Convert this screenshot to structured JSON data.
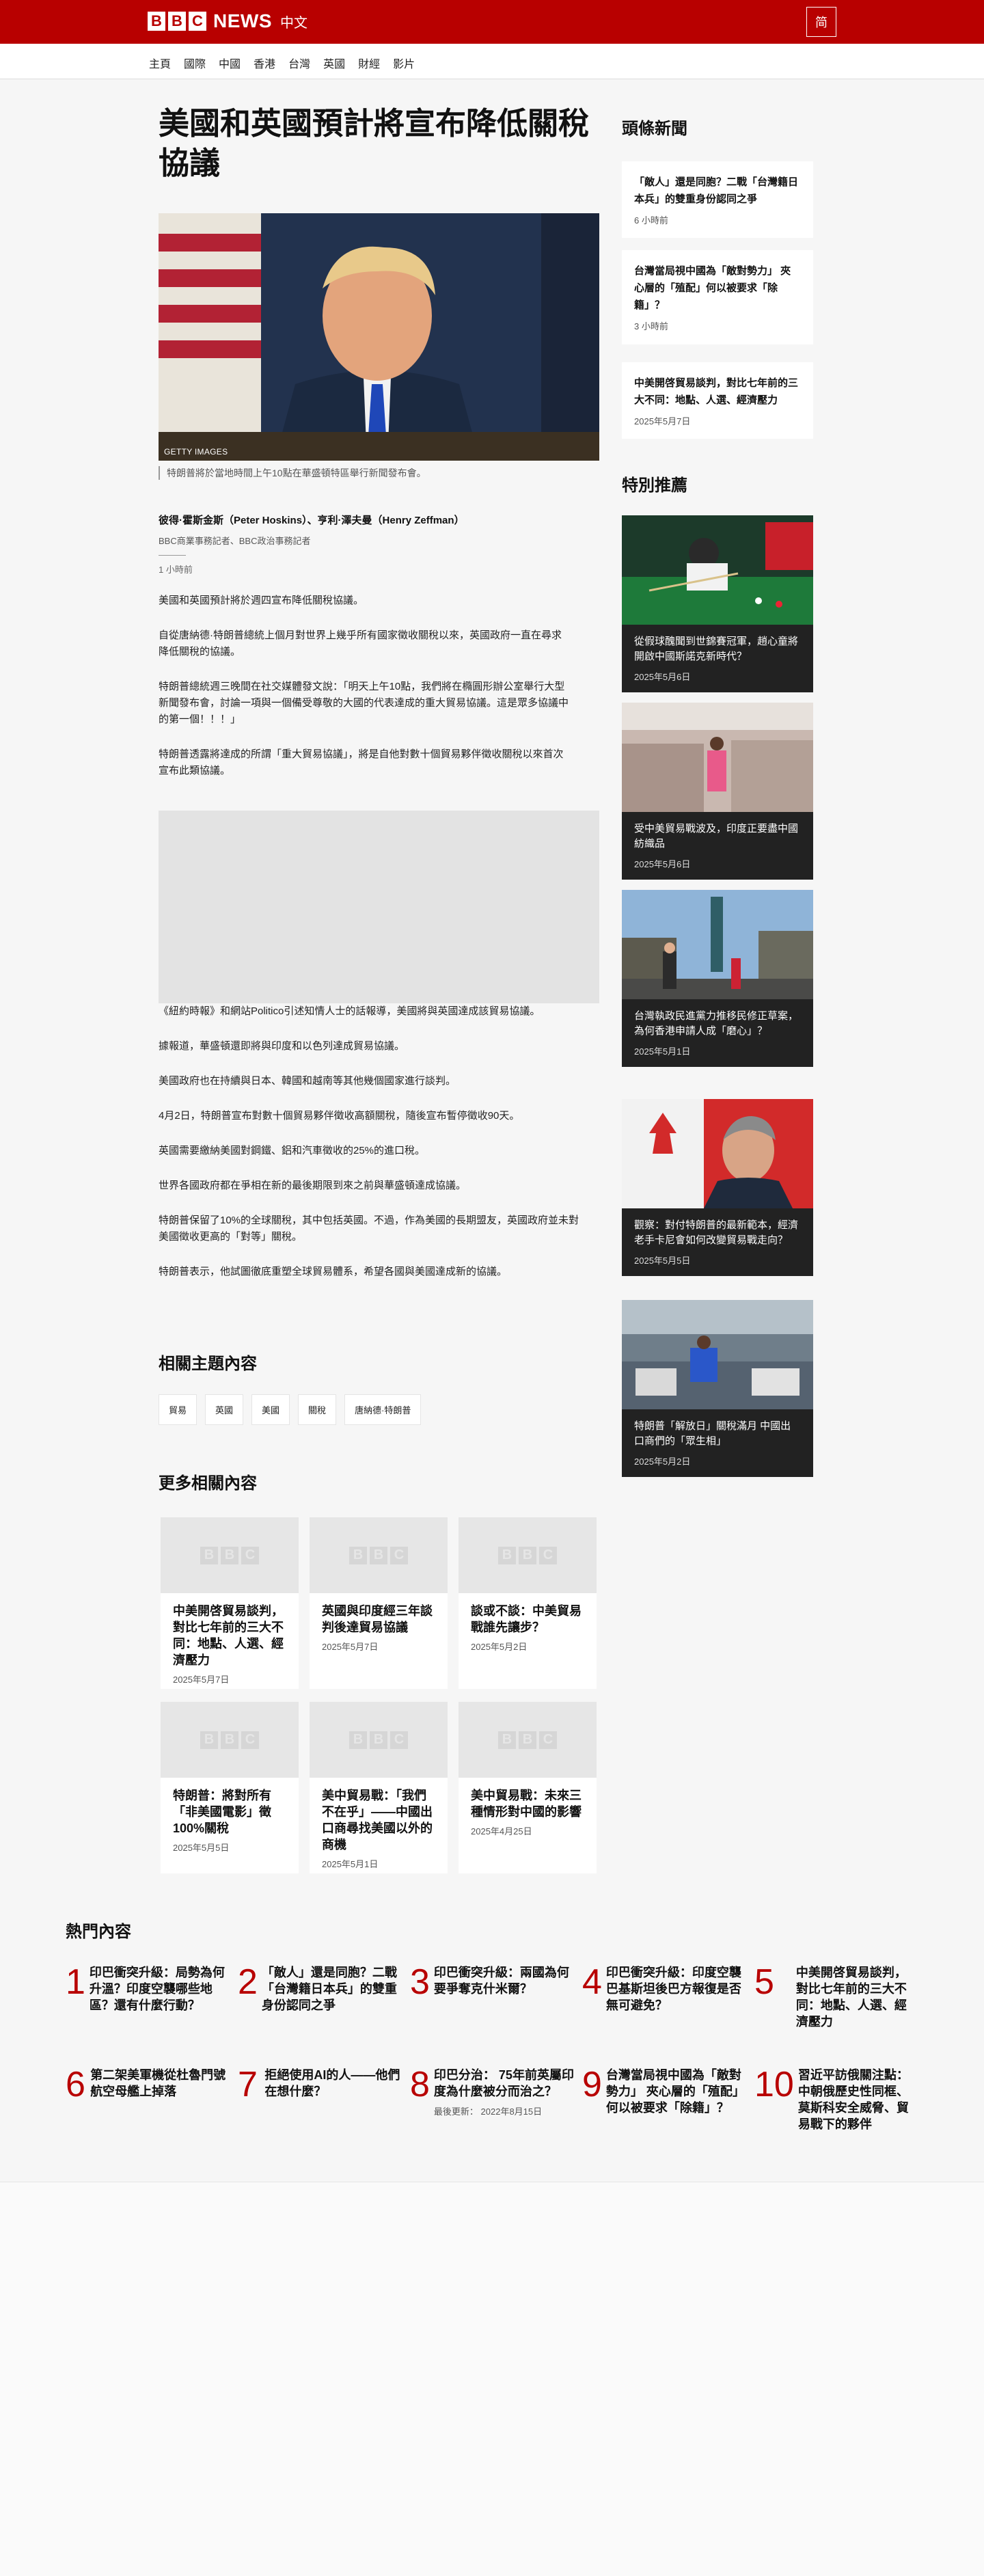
{
  "header": {
    "logo_letters": [
      "B",
      "B",
      "C"
    ],
    "brand": "NEWS",
    "edition": "中文",
    "lang_toggle": "简"
  },
  "nav": {
    "items": [
      "主頁",
      "國際",
      "中國",
      "香港",
      "台灣",
      "英國",
      "財經",
      "影片"
    ]
  },
  "article": {
    "headline": "美國和英國預計將宣布降低關稅協議",
    "image_credit": "GETTY IMAGES",
    "caption": "特朗普將於當地時間上午10點在華盛頓特區舉行新聞發布會。",
    "author": "彼得·霍斯金斯（Peter Hoskins）、亨利·澤夫曼（Henry Zeffman）",
    "author_role": "BBC商業事務記者、BBC政治事務記者",
    "time": "1 小時前",
    "paragraphs_a": [
      "美國和英國預計將於週四宣布降低關稅協議。",
      "自從唐納德·特朗普總統上個月對世界上幾乎所有國家徵收關稅以來，英國政府一直在尋求降低關稅的協議。",
      "特朗普總統週三晚間在社交媒體發文說：「明天上午10點，我們將在橢圓形辦公室舉行大型新聞發布會，討論一項與一個備受尊敬的大國的代表達成的重大貿易協議。這是眾多協議中的第一個！！！」",
      "特朗普透露將達成的所謂「重大貿易協議」，將是自他對數十個貿易夥伴徵收關稅以來首次宣布此類協議。"
    ],
    "paragraphs_b": [
      "《紐約時報》和網站Politico引述知情人士的話報導，美國將與英國達成該貿易協議。",
      "據報道，華盛頓還即將與印度和以色列達成貿易協議。",
      "美國政府也在持續與日本、韓國和越南等其他幾個國家進行談判。",
      "4月2日，特朗普宣布對數十個貿易夥伴徵收高額關稅，隨後宣布暫停徵收90天。",
      "英國需要繳納美國對鋼鐵、鋁和汽車徵收的25%的進口稅。",
      "世界各國政府都在爭相在新的最後期限到來之前與華盛頓達成協議。",
      "特朗普保留了10%的全球關稅，其中包括英國。不過，作為美國的長期盟友，英國政府並未對美國徵收更高的「對等」關稅。",
      "特朗普表示，他試圖徹底重塑全球貿易體系，希望各國與美國達成新的協議。"
    ]
  },
  "related_topics": {
    "heading": "相關主題內容",
    "tags": [
      "貿易",
      "英國",
      "美國",
      "關稅",
      "唐納德·特朗普"
    ]
  },
  "more_related": {
    "heading": "更多相關內容",
    "cards": [
      {
        "title": "中美開啓貿易談判，對比七年前的三大不同：地點、人選、經濟壓力",
        "date": "2025年5月7日"
      },
      {
        "title": "英國與印度經三年談判後達貿易協議",
        "date": "2025年5月7日"
      },
      {
        "title": "談或不談：中美貿易戰誰先讓步？",
        "date": "2025年5月2日"
      },
      {
        "title": "特朗普：將對所有「非美國電影」徵100%關稅",
        "date": "2025年5月5日"
      },
      {
        "title": "美中貿易戰：「我們不在乎」——中國出口商尋找美國以外的商機",
        "date": "2025年5月1日"
      },
      {
        "title": "美中貿易戰：未來三種情形對中國的影響",
        "date": "2025年4月25日"
      }
    ]
  },
  "hot": {
    "heading": "熱門內容",
    "items": [
      {
        "num": "1",
        "title": "印巴衝突升級：局勢為何升溫？印度空襲哪些地區？還有什麼行動？",
        "meta": ""
      },
      {
        "num": "2",
        "title": "「敵人」還是同胞？二戰「台灣籍日本兵」的雙重身份認同之爭",
        "meta": ""
      },
      {
        "num": "3",
        "title": "印巴衝突升級：兩國為何要爭奪克什米爾？",
        "meta": ""
      },
      {
        "num": "4",
        "title": "印巴衝突升級：印度空襲巴基斯坦後巴方報復是否無可避免？",
        "meta": ""
      },
      {
        "num": "5",
        "title": "中美開啓貿易談判，對比七年前的三大不同：地點、人選、經濟壓力",
        "meta": ""
      },
      {
        "num": "6",
        "title": "第二架美軍機從杜魯門號航空母艦上掉落",
        "meta": ""
      },
      {
        "num": "7",
        "title": "拒絕使用AI的人——他們在想什麼？",
        "meta": ""
      },
      {
        "num": "8",
        "title": "印巴分治： 75年前英屬印度為什麼被分而治之？",
        "meta": "最後更新： 2022年8月15日"
      },
      {
        "num": "9",
        "title": "台灣當局視中國為「敵對勢力」 夾心層的「殖配」何以被要求「除籍」？",
        "meta": ""
      },
      {
        "num": "10",
        "title": "習近平訪俄關注點：中朝俄歷史性同框、莫斯科安全威脅、貿易戰下的夥伴",
        "meta": ""
      }
    ]
  },
  "sidebar": {
    "top_heading": "頭條新聞",
    "top_items": [
      {
        "title": "「敵人」還是同胞？二戰「台灣籍日本兵」的雙重身份認同之爭",
        "time": "6 小時前"
      },
      {
        "title": "台灣當局視中國為「敵對勢力」 夾心層的「殖配」何以被要求「除籍」？",
        "time": "3 小時前"
      },
      {
        "title": "中美開啓貿易談判，對比七年前的三大不同：地點、人選、經濟壓力",
        "time": "2025年5月7日"
      }
    ],
    "feature_heading": "特別推薦",
    "features": [
      {
        "title": "從假球醜聞到世錦賽冠軍，趙心童將開啟中國斯諾克新時代？",
        "date": "2025年5月6日"
      },
      {
        "title": "受中美貿易戰波及，印度正要盡中國紡織品",
        "date": "2025年5月6日"
      },
      {
        "title": "台灣執政民進黨力推移民修正草案，為何香港申請人成「磨心」？",
        "date": "2025年5月1日"
      },
      {
        "title": "觀察：對付特朗普的最新範本，經濟老手卡尼會如何改變貿易戰走向？",
        "date": "2025年5月5日"
      },
      {
        "title": "特朗普「解放日」關稅滿月 中國出口商們的「眾生相」",
        "date": "2025年5月2日"
      }
    ]
  },
  "colors": {
    "brand_red": "#b80000",
    "background": "#f6f6f6"
  }
}
